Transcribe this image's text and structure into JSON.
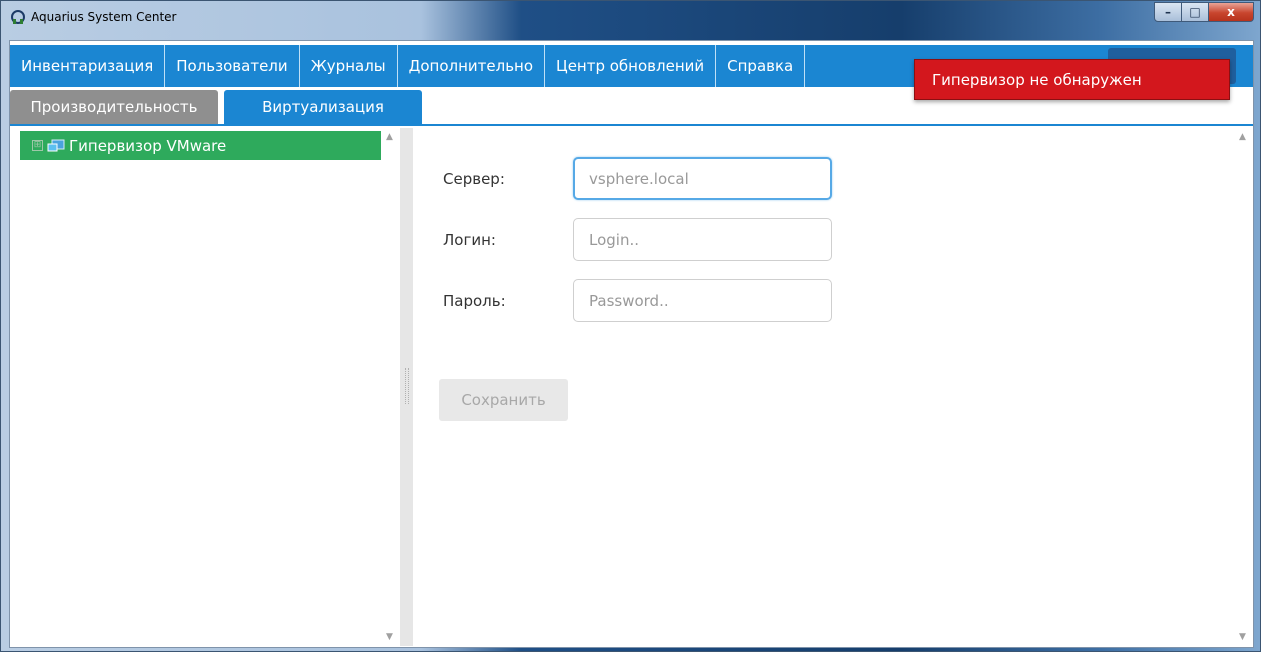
{
  "window": {
    "title": "Aquarius System Center",
    "controls": {
      "minimize": "–",
      "maximize": "□",
      "close": "x"
    }
  },
  "menu": {
    "items": [
      {
        "label": "Инвентаризация"
      },
      {
        "label": "Пользователи"
      },
      {
        "label": "Журналы"
      },
      {
        "label": "Дополнительно"
      },
      {
        "label": "Центр обновлений"
      },
      {
        "label": "Справка"
      }
    ]
  },
  "tabs": [
    {
      "label": "Производительность",
      "active": false
    },
    {
      "label": "Виртуализация",
      "active": true
    }
  ],
  "tree": {
    "items": [
      {
        "label": "Гипервизор VMware",
        "expander": "⊞"
      }
    ]
  },
  "form": {
    "server_label": "Сервер:",
    "server_placeholder": "vsphere.local",
    "login_label": "Логин:",
    "login_placeholder": "Login..",
    "password_label": "Пароль:",
    "password_placeholder": "Password..",
    "save_label": "Сохранить"
  },
  "notification": {
    "text": "Гипервизор не обнаружен"
  },
  "colors": {
    "menu_bg": "#1b86d2",
    "tree_selected": "#2eaa5c",
    "toast_bg": "#d3171d",
    "inactive_tab": "#8f8f8f"
  }
}
